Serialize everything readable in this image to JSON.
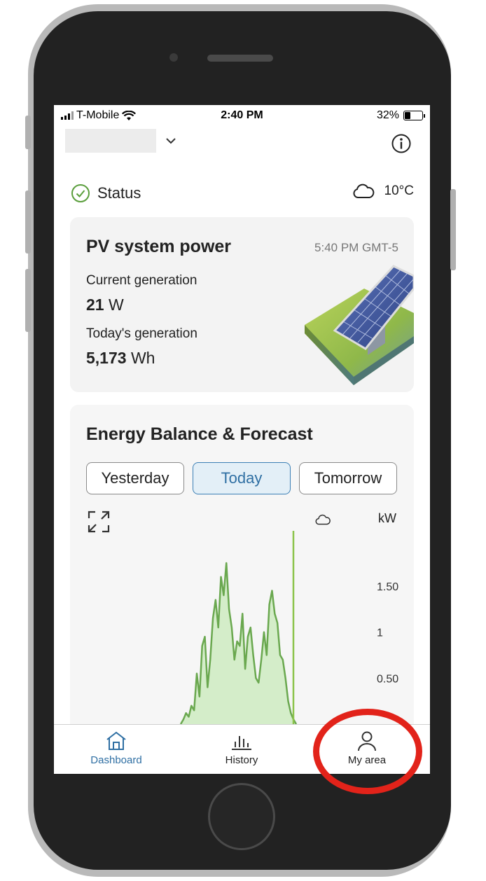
{
  "statusbar": {
    "carrier": "T-Mobile",
    "time": "2:40 PM",
    "battery": "32%",
    "battery_level": 0.32
  },
  "status": {
    "label": "Status",
    "temperature": "10°C"
  },
  "pv_card": {
    "title": "PV system power",
    "timestamp": "5:40 PM GMT-5",
    "current_label": "Current generation",
    "current_value": "21",
    "current_unit": "W",
    "today_label": "Today's generation",
    "today_value": "5,173",
    "today_unit": "Wh"
  },
  "energy_card": {
    "title": "Energy Balance & Forecast",
    "tabs": [
      "Yesterday",
      "Today",
      "Tomorrow"
    ],
    "active_tab": "Today",
    "unit": "kW"
  },
  "chart_data": {
    "type": "area",
    "ylabel": "kW",
    "yticks": [
      "1.50",
      "1",
      "0.50"
    ],
    "ylim": [
      0,
      2.1
    ],
    "color": "#6aa84f",
    "fill": "#d4edc9",
    "series": [
      {
        "values": [
          0.0,
          0.05,
          0.12,
          0.08,
          0.2,
          0.15,
          0.55,
          0.3,
          0.85,
          0.95,
          0.4,
          0.7,
          1.15,
          1.35,
          1.05,
          1.6,
          1.4,
          1.75,
          1.25,
          1.05,
          0.7,
          0.9,
          0.85,
          1.2,
          0.6,
          0.95,
          1.05,
          0.75,
          0.5,
          0.45,
          0.7,
          1.0,
          0.75,
          1.3,
          1.45,
          1.2,
          1.1,
          0.75,
          0.7,
          0.5,
          0.25,
          0.12,
          0.05,
          0.0
        ]
      }
    ]
  },
  "bottomnav": {
    "items": [
      {
        "label": "Dashboard"
      },
      {
        "label": "History"
      },
      {
        "label": "My area"
      }
    ]
  }
}
